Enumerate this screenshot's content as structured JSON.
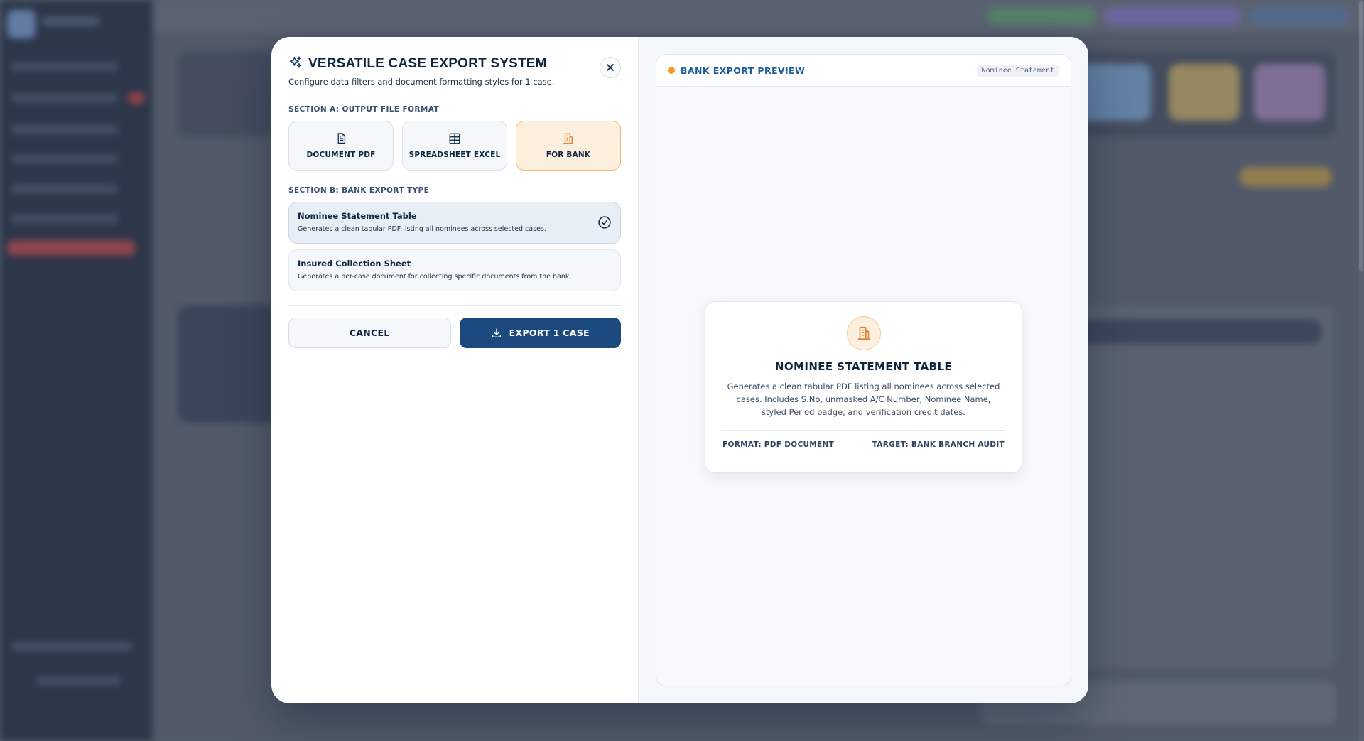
{
  "modal": {
    "title": "VERSATILE CASE EXPORT SYSTEM",
    "subtitle": "Configure data filters and document formatting styles for 1 case."
  },
  "section_a": {
    "label": "SECTION A: OUTPUT FILE FORMAT",
    "formats": [
      {
        "label": "DOCUMENT PDF",
        "icon": "document-icon",
        "selected": false
      },
      {
        "label": "SPREADSHEET EXCEL",
        "icon": "table-grid-icon",
        "selected": false
      },
      {
        "label": "FOR BANK",
        "icon": "bank-building-icon",
        "selected": true
      }
    ]
  },
  "section_b": {
    "label": "SECTION B: BANK EXPORT TYPE",
    "options": [
      {
        "title": "Nominee Statement Table",
        "desc": "Generates a clean tabular PDF listing all nominees across selected cases.",
        "selected": true
      },
      {
        "title": "Insured Collection Sheet",
        "desc": "Generates a per-case document for collecting specific documents from the bank.",
        "selected": false
      }
    ]
  },
  "actions": {
    "cancel": "CANCEL",
    "export": "EXPORT 1 CASE"
  },
  "preview": {
    "title": "BANK EXPORT PREVIEW",
    "tag": "Nominee Statement",
    "card_title": "NOMINEE STATEMENT TABLE",
    "card_desc": "Generates a clean tabular PDF listing all nominees across selected cases. Includes S.No, unmasked A/C Number, Nominee Name, styled Period badge, and verification credit dates.",
    "format": "FORMAT: PDF DOCUMENT",
    "target": "TARGET: BANK BRANCH AUDIT"
  },
  "colors": {
    "accent": "#1c4a7e",
    "selected_bg": "#fcefde",
    "selected_border": "#f2b86c",
    "preview_dot": "#f39b1c",
    "preview_title": "#1d5d9c"
  }
}
